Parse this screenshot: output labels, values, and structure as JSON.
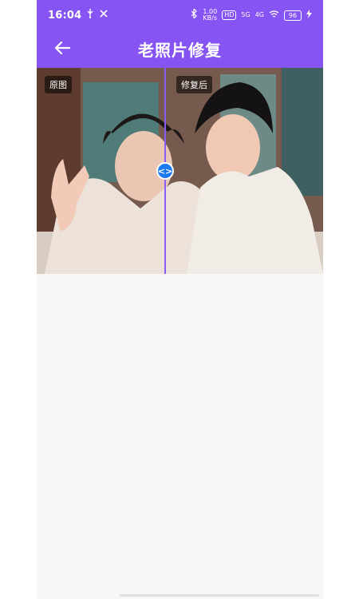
{
  "status_bar": {
    "time": "16:04",
    "network_speed_top": "1.00",
    "network_speed_bottom": "KB/s",
    "hd_badge": "HD",
    "signal_1": "5G",
    "signal_2": "4G",
    "battery": "96",
    "icons": [
      "usb-icon",
      "tools-icon",
      "bluetooth-icon",
      "wifi-icon",
      "charging-icon"
    ]
  },
  "header": {
    "title": "老照片修复",
    "back_icon": "arrow-left-icon",
    "color": "#8654f2"
  },
  "comparison": {
    "left_label": "原图",
    "right_label": "修复后",
    "handle_symbol": "<>"
  }
}
